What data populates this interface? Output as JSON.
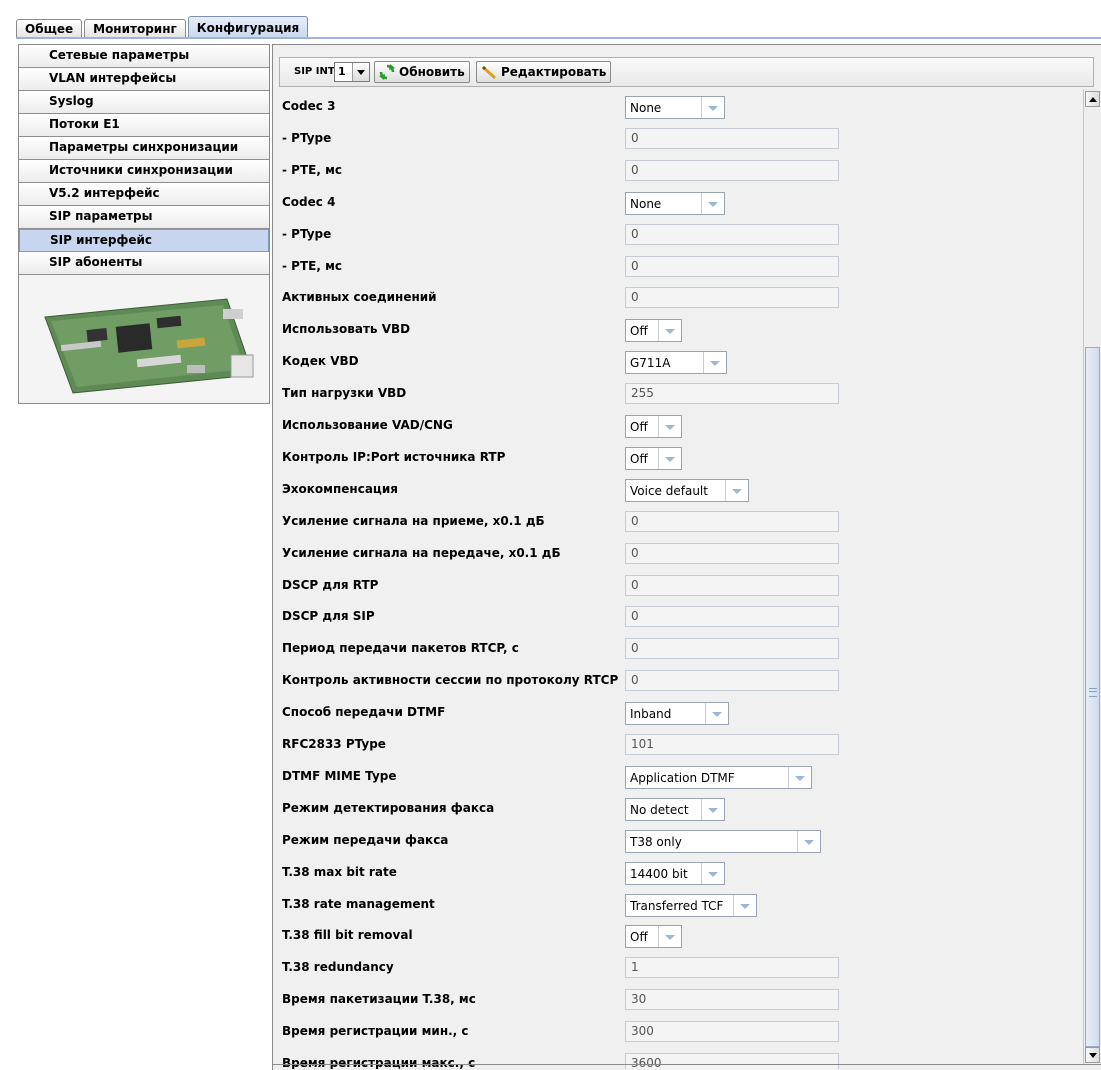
{
  "tabs": [
    {
      "label": "Общее",
      "active": false
    },
    {
      "label": "Мониторинг",
      "active": false
    },
    {
      "label": "Конфигурация",
      "active": true
    }
  ],
  "sidebar": {
    "items": [
      {
        "label": "Сетевые параметры"
      },
      {
        "label": "VLAN интерфейсы"
      },
      {
        "label": "Syslog"
      },
      {
        "label": "Потоки E1"
      },
      {
        "label": "Параметры синхронизации"
      },
      {
        "label": "Источники синхронизации"
      },
      {
        "label": "V5.2 интерфейс"
      },
      {
        "label": "SIP параметры"
      },
      {
        "label": "SIP интерфейс",
        "selected": true
      },
      {
        "label": "SIP абоненты"
      }
    ]
  },
  "toolbar": {
    "intf_label": "SIP INTF",
    "intf_value": "1",
    "refresh_label": "Обновить",
    "edit_label": "Редактировать"
  },
  "form": {
    "rows": [
      {
        "label": "Codec 3",
        "type": "select",
        "value": "None"
      },
      {
        "label": "- PType",
        "type": "text",
        "value": "0"
      },
      {
        "label": "- PTE, мс",
        "type": "text",
        "value": "0"
      },
      {
        "label": "Codec 4",
        "type": "select",
        "value": "None"
      },
      {
        "label": "- PType",
        "type": "text",
        "value": "0"
      },
      {
        "label": "- PTE, мс",
        "type": "text",
        "value": "0"
      },
      {
        "label": "Активных соединений",
        "type": "text",
        "value": "0"
      },
      {
        "label": "Использовать VBD",
        "type": "select",
        "value": "Off"
      },
      {
        "label": "Кодек VBD",
        "type": "select",
        "value": "G711A"
      },
      {
        "label": "Тип нагрузки VBD",
        "type": "text",
        "value": "255"
      },
      {
        "label": "Использование VAD/CNG",
        "type": "select",
        "value": "Off"
      },
      {
        "label": "Контроль IP:Port источника RTP",
        "type": "select",
        "value": "Off"
      },
      {
        "label": "Эхокомпенсация",
        "type": "select",
        "value": "Voice default"
      },
      {
        "label": "Усиление сигнала на приеме, x0.1 дБ",
        "type": "text",
        "value": "0"
      },
      {
        "label": "Усиление сигнала на передаче, x0.1 дБ",
        "type": "text",
        "value": "0"
      },
      {
        "label": "DSCP для RTP",
        "type": "text",
        "value": "0"
      },
      {
        "label": "DSCP для SIP",
        "type": "text",
        "value": "0"
      },
      {
        "label": "Период передачи пакетов RTCP, с",
        "type": "text",
        "value": "0"
      },
      {
        "label": "Контроль активности сессии по протоколу RTCP",
        "type": "text",
        "value": "0"
      },
      {
        "label": "Способ передачи DTMF",
        "type": "select",
        "value": "Inband"
      },
      {
        "label": "RFC2833 PType",
        "type": "text",
        "value": "101"
      },
      {
        "label": "DTMF MIME Type",
        "type": "select",
        "value": "Application DTMF"
      },
      {
        "label": "Режим детектирования факса",
        "type": "select",
        "value": "No detect"
      },
      {
        "label": "Режим передачи факса",
        "type": "select",
        "value": "T38 only"
      },
      {
        "label": "T.38 max bit rate",
        "type": "select",
        "value": "14400 bit"
      },
      {
        "label": "T.38 rate management",
        "type": "select",
        "value": "Transferred TCF"
      },
      {
        "label": "T.38 fill bit removal",
        "type": "select",
        "value": "Off"
      },
      {
        "label": "T.38 redundancy",
        "type": "text",
        "value": "1"
      },
      {
        "label": "Время пакетизации T.38, мс",
        "type": "text",
        "value": "30"
      },
      {
        "label": "Время регистрации мин., с",
        "type": "text",
        "value": "300"
      },
      {
        "label": "Время регистрации макс., с",
        "type": "text",
        "value": "3600"
      }
    ]
  }
}
